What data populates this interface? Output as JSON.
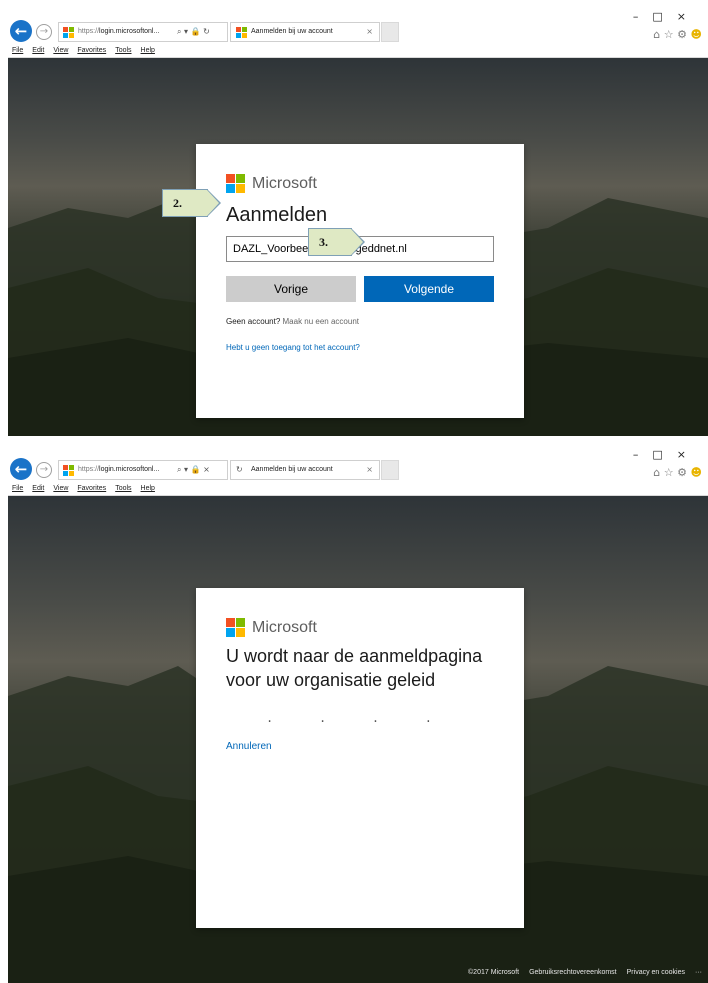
{
  "colors": {
    "accent": "#0067b8",
    "ms_red": "#f25022",
    "ms_green": "#7fba00",
    "ms_blue": "#00a4ef",
    "ms_yellow": "#ffb900",
    "callout_fill": "#dfe9c4"
  },
  "browser": {
    "url_scheme": "https://",
    "url_host": "login.microsoftonl...",
    "tab_title": "Aanmelden bij uw account",
    "menu": [
      "File",
      "Edit",
      "View",
      "Favorites",
      "Tools",
      "Help"
    ],
    "icons": {
      "back": "back-arrow-icon",
      "forward": "forward-arrow-icon",
      "search": "search-icon",
      "lock": "lock-icon",
      "refresh": "refresh-icon",
      "stop": "stop-icon",
      "home": "home-icon",
      "favorites": "star-icon",
      "settings": "gear-icon",
      "feedback": "smiley-icon"
    }
  },
  "screen1": {
    "brand": "Microsoft",
    "title": "Aanmelden",
    "email_value": "DAZL_Voorbeeld@manageddnet.nl",
    "back_button": "Vorige",
    "next_button": "Volgende",
    "no_account_text": "Geen account?",
    "create_account_link": "Maak nu een account",
    "no_access_link": "Hebt u geen toegang tot het account?",
    "callout_2": "2.",
    "callout_3": "3."
  },
  "screen2": {
    "brand": "Microsoft",
    "redirect_text": "U wordt naar de aanmeldpagina voor uw organisatie geleid",
    "progress_dots": ". . . .",
    "cancel_link": "Annuleren",
    "footer_copyright": "©2017 Microsoft",
    "footer_terms": "Gebruiksrechtovereenkomst",
    "footer_privacy": "Privacy en cookies",
    "footer_more": "···"
  }
}
